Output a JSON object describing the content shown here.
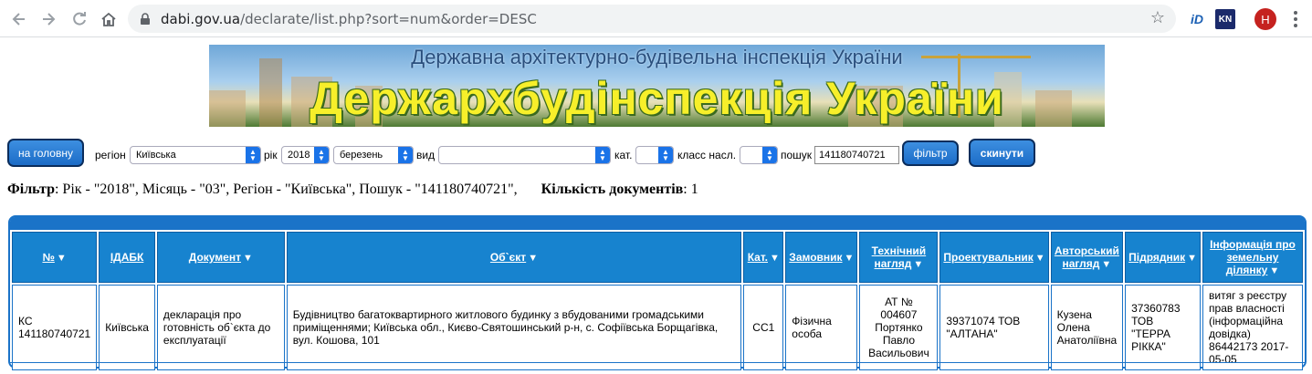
{
  "browser": {
    "url_host": "dabi.gov.ua",
    "url_path": "/declarate/list.php?sort=num&order=DESC",
    "avatar_letter": "Н",
    "ext_id_label": "iD",
    "ext_kn_label": "KN"
  },
  "banner": {
    "top_text": "Державна архітектурно-будівельна інспекція України",
    "main_text": "Держархбудінспекція України"
  },
  "filters": {
    "home_button": "на головну",
    "region_label": "регіон",
    "region_value": "Київська",
    "year_label": "рік",
    "year_value": "2018",
    "month_value": "березень",
    "type_label": "вид",
    "type_value": "",
    "cat_label": "кат.",
    "cat_value": "",
    "class_label": "класс насл.",
    "class_value": "",
    "search_label": "пошук",
    "search_value": "141180740721",
    "filter_button": "фільтр",
    "reset_button": "скинути"
  },
  "summary": {
    "filter_label": "Фільтр",
    "filter_text": ": Рік - \"2018\", Місяць - \"03\", Регіон - \"Київська\", Пошук - \"141180740721\",",
    "count_label": "Кількість документів",
    "count_value": ": 1"
  },
  "table": {
    "headers": {
      "num": "№",
      "idabk": "ІДАБК",
      "document": "Документ",
      "object": "Об`єкт",
      "cat": "Кат.",
      "customer": "Замовник",
      "tech_l1": "Технічний",
      "tech_l2": "нагляд",
      "designer": "Проектувальник",
      "author_l1": "Авторський",
      "author_l2": "нагляд",
      "contractor": "Підрядник",
      "land_l1": "Інформація про",
      "land_l2": "земельну ділянку"
    },
    "row": {
      "num_l1": "КС",
      "num_l2": "141180740721",
      "idabk": "Київська",
      "document": "декларація про готовність об`єкта до експлуатації",
      "object": "Будівництво багатоквартирного житлового будинку з вбудованими громадськими приміщеннями; Київська обл., Києво-Святошинський р-н, с. Софіївська Борщагівка, вул. Кошова, 101",
      "cat": "СС1",
      "customer": "Фізична особа",
      "tech": "АТ № 004607 Портянко Павло Васильович",
      "designer": "39371074 ТОВ \"АЛТАНА\"",
      "author": "Кузена Олена Анатоліївна",
      "contractor": "37360783 ТОВ \"ТЕРРА РІККА\"",
      "land": "витяг з реєстру прав власності (інформаційна довідка) 86442173 2017-05-05"
    }
  }
}
